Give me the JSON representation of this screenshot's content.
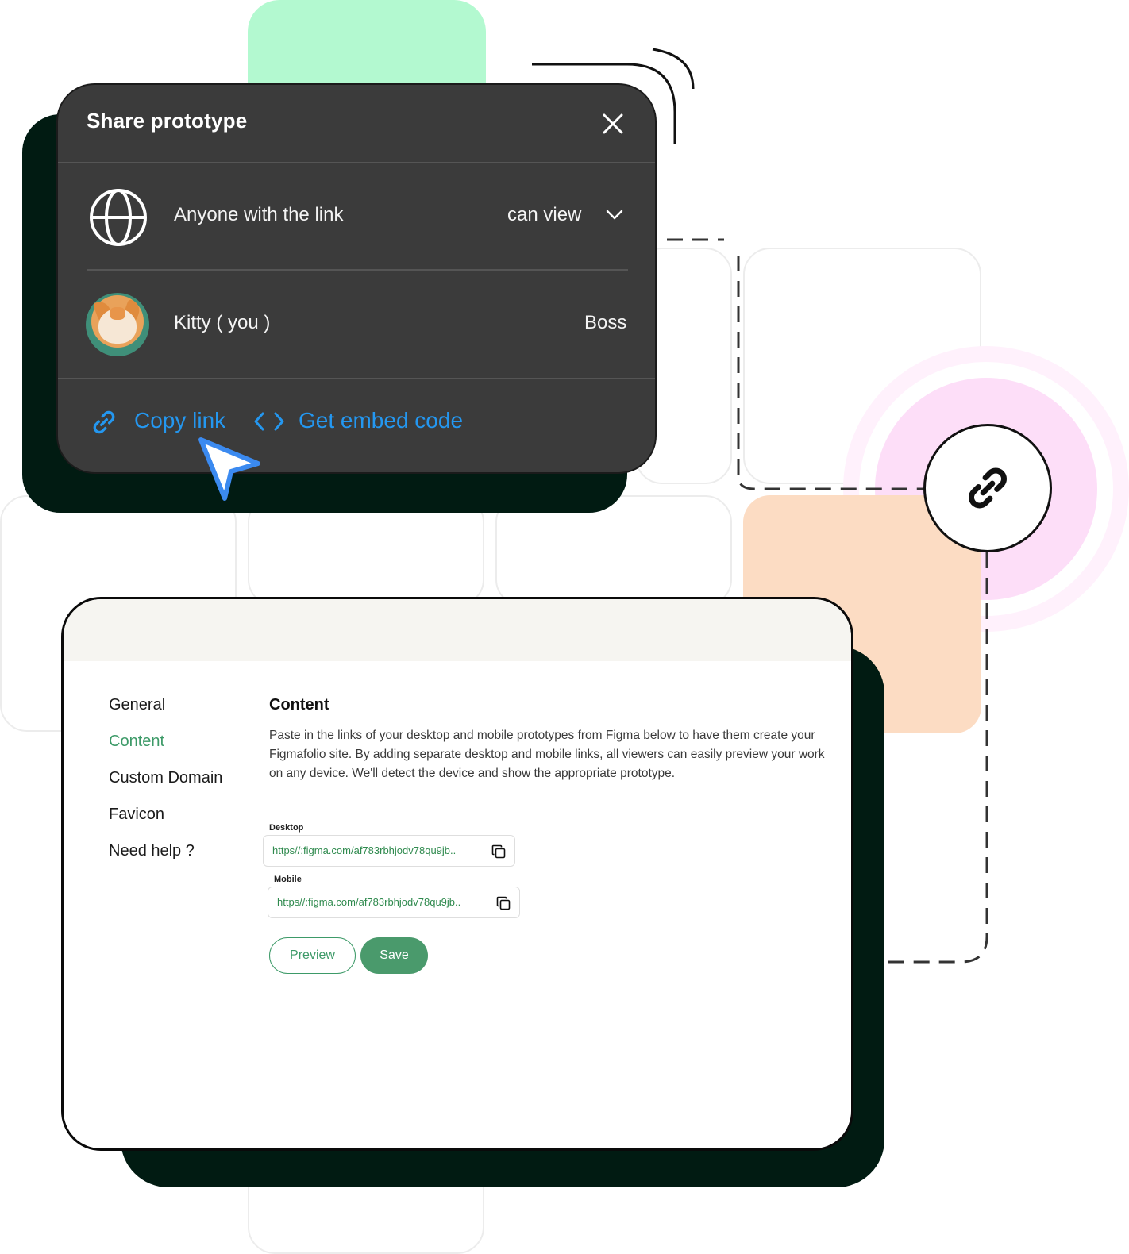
{
  "share_dialog": {
    "title": "Share prototype",
    "access_label": "Anyone with the link",
    "permission": "can view",
    "user_name": "Kitty ( you )",
    "user_role": "Boss",
    "copy_link": "Copy link",
    "embed_code": "Get embed code"
  },
  "settings": {
    "nav": [
      "General",
      "Content",
      "Custom Domain",
      "Favicon",
      "Need help ?"
    ],
    "active_nav": "Content",
    "content_title": "Content",
    "content_description": "Paste in the links of your desktop and mobile prototypes from Figma below to have them create your Figmafolio site. By adding separate desktop and mobile links, all viewers can easily preview your work on any device. We'll detect the device and show the appropriate prototype.",
    "desktop_label": "Desktop",
    "desktop_url": "https//:figma.com/af783rbhjodv78qu9jb..",
    "mobile_label": "Mobile",
    "mobile_url": "https//:figma.com/af783rbhjodv78qu9jb..",
    "preview_button": "Preview",
    "save_button": "Save"
  },
  "colors": {
    "accent_green": "#3d9a68",
    "link_blue": "#2497f0",
    "dialog_bg": "#3b3b3b",
    "shadow": "#011b12",
    "mint_tile": "#b3f9d0",
    "peach_tile": "#fcdcc3",
    "pink_glow": "#fddef8"
  }
}
